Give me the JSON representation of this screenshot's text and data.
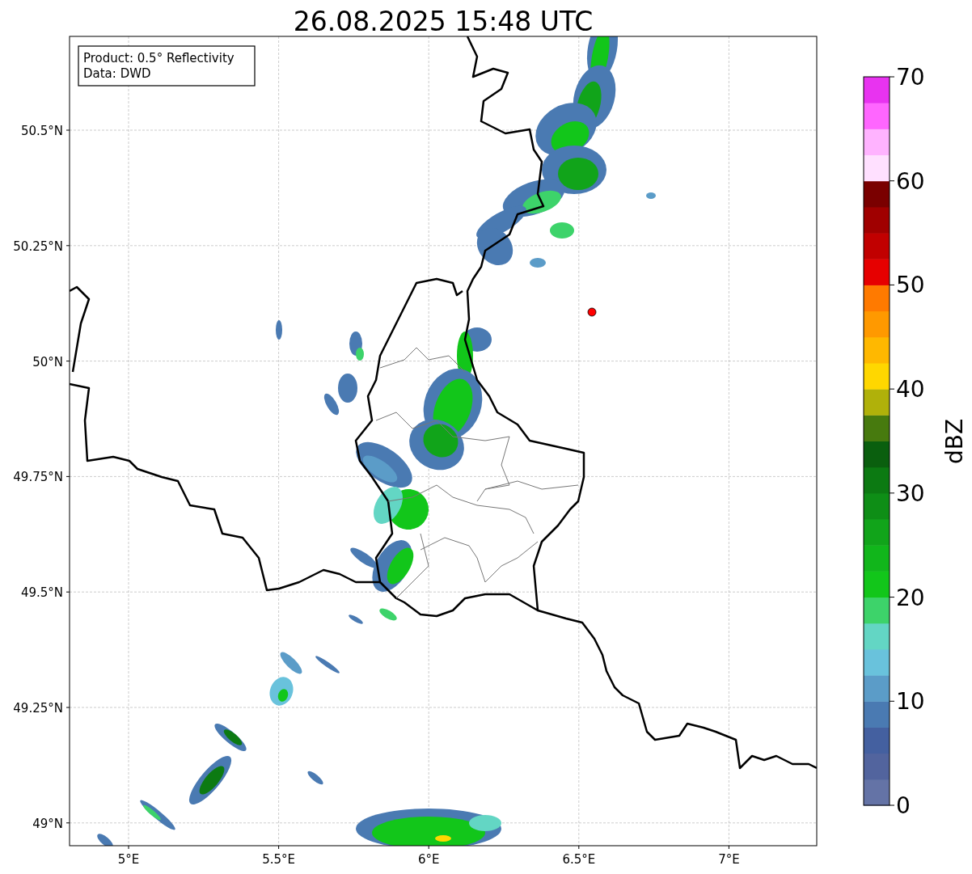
{
  "title": "26.08.2025 15:48 UTC",
  "info_box": {
    "lines": [
      "Product: 0.5° Reflectivity",
      "Data: DWD"
    ]
  },
  "map": {
    "xticks": [
      "5°E",
      "5.5°E",
      "6°E",
      "6.5°E",
      "7°E"
    ],
    "yticks": [
      "50.5°N",
      "50.25°N",
      "50°N",
      "49.75°N",
      "49.5°N",
      "49.25°N",
      "49°N"
    ]
  },
  "colorbar": {
    "label": "dBZ",
    "ticks": [
      "70",
      "60",
      "50",
      "40",
      "30",
      "20",
      "10",
      "0"
    ],
    "segments": [
      {
        "color": "#6473a6"
      },
      {
        "color": "#52649e"
      },
      {
        "color": "#4460a0"
      },
      {
        "color": "#4a7ab2"
      },
      {
        "color": "#5b9cc8"
      },
      {
        "color": "#69c2dc"
      },
      {
        "color": "#63d6c4"
      },
      {
        "color": "#3dd36a"
      },
      {
        "color": "#12c61a"
      },
      {
        "color": "#11b61b"
      },
      {
        "color": "#11a41a"
      },
      {
        "color": "#0e8e16"
      },
      {
        "color": "#0c7a12"
      },
      {
        "color": "#0a5f0e"
      },
      {
        "color": "#477a0e"
      },
      {
        "color": "#b0b10a"
      },
      {
        "color": "#ffd700"
      },
      {
        "color": "#ffb800"
      },
      {
        "color": "#ff9900"
      },
      {
        "color": "#ff7a00"
      },
      {
        "color": "#e60000"
      },
      {
        "color": "#c10000"
      },
      {
        "color": "#a00000"
      },
      {
        "color": "#7a0000"
      },
      {
        "color": "#ffe0ff"
      },
      {
        "color": "#ffb3ff"
      },
      {
        "color": "#ff66ff"
      },
      {
        "color": "#e833f0"
      }
    ]
  }
}
